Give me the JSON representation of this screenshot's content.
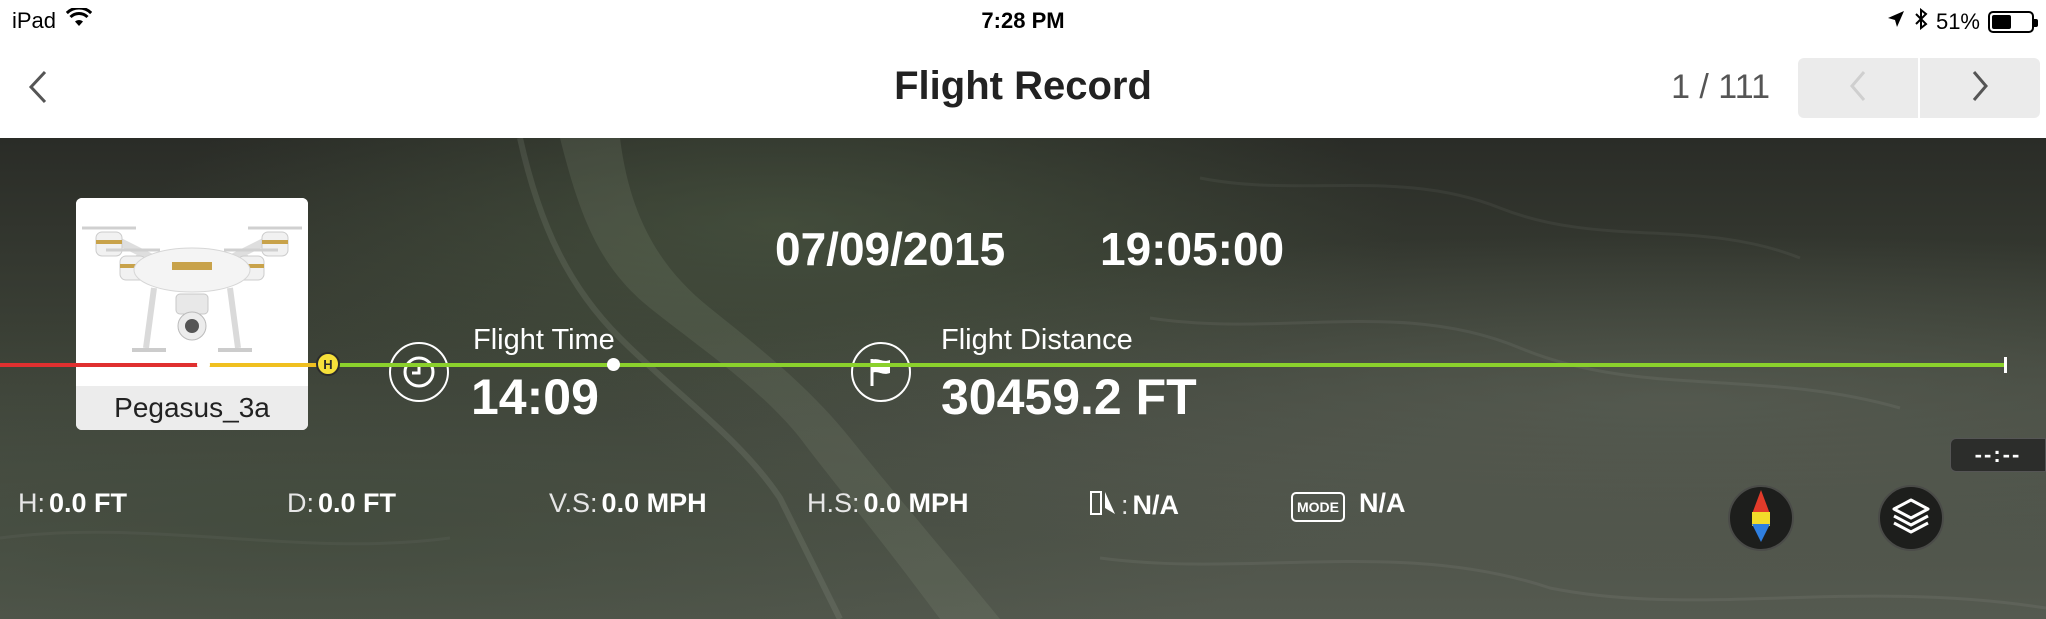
{
  "status_bar": {
    "device": "iPad",
    "time": "7:28 PM",
    "battery_percent": "51%",
    "battery_level": 0.51,
    "icons": [
      "wifi-icon",
      "location-arrow-icon",
      "bluetooth-icon",
      "battery-icon"
    ]
  },
  "navbar": {
    "title": "Flight Record",
    "page_counter": "1 / 111",
    "icons": [
      "chevron-left-icon",
      "chevron-left-icon",
      "chevron-right-icon"
    ]
  },
  "record": {
    "aircraft_name": "Pegasus_3a",
    "date": "07/09/2015",
    "time": "19:05:00",
    "flight_time_label": "Flight Time",
    "flight_time_value": "14:09",
    "flight_distance_label": "Flight Distance",
    "flight_distance_value": "30459.2 FT",
    "icons": [
      "clock-icon",
      "flag-icon"
    ]
  },
  "timeline": {
    "home_label": "H",
    "time_tag": "--:--"
  },
  "telemetry": {
    "height_label": "H:",
    "height_value": "0.0 FT",
    "distance_label": "D:",
    "distance_value": "0.0 FT",
    "vs_label": "V.S:",
    "vs_value": "0.0 MPH",
    "hs_label": "H.S:",
    "hs_value": "0.0 MPH",
    "gps_label": ":",
    "gps_value": "N/A",
    "mode_badge": "MODE",
    "mode_value": "N/A"
  },
  "controls": {
    "icons": [
      "compass-icon",
      "layers-icon"
    ]
  },
  "colors": {
    "timeline_red": "#e03030",
    "timeline_yellow": "#f0c020",
    "timeline_green": "#8bd12c",
    "home_marker": "#f6e03a"
  }
}
